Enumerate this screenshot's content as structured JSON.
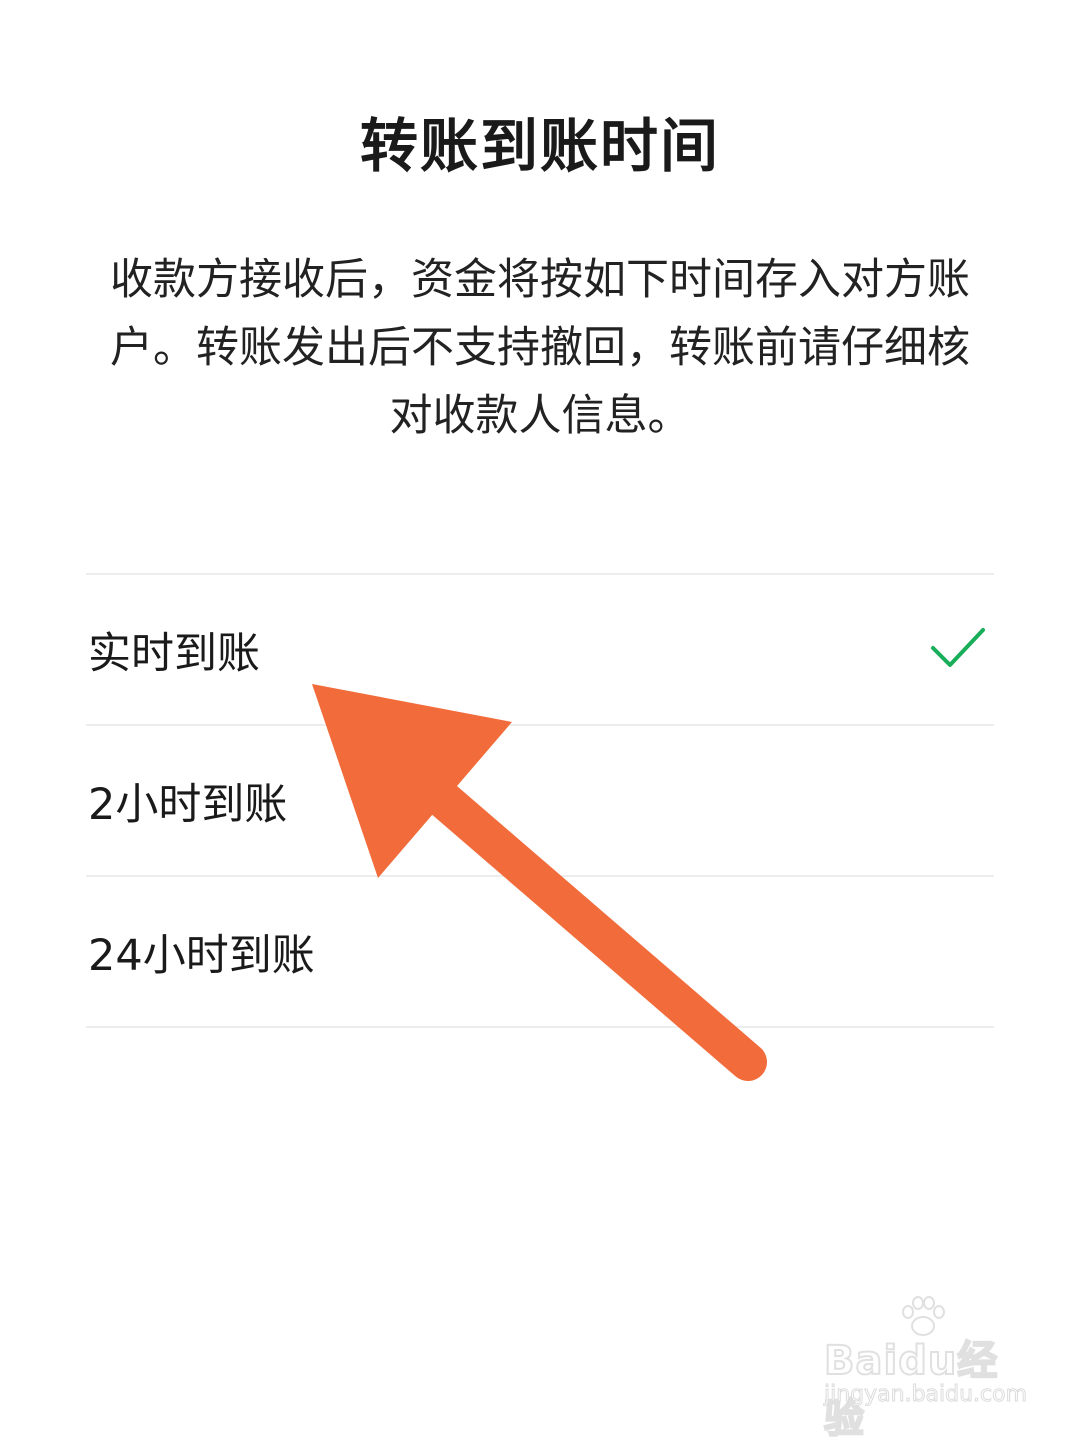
{
  "dialog": {
    "title": "转账到账时间",
    "description": "收款方接收后，资金将按如下时间存入对方账户。转账发出后不支持撤回，转账前请仔细核对收款人信息。"
  },
  "options": [
    {
      "label": "实时到账",
      "selected": true
    },
    {
      "label": "2小时到账",
      "selected": false
    },
    {
      "label": "24小时到账",
      "selected": false
    }
  ],
  "icons": {
    "selected": "check-icon",
    "annotation": "arrow-annotation"
  },
  "colors": {
    "check": "#1aad5a",
    "arrow": "#f26b3a",
    "divider": "#ededed"
  },
  "watermark": {
    "brand": "Baidu经验",
    "url": "jingyan.baidu.com"
  }
}
